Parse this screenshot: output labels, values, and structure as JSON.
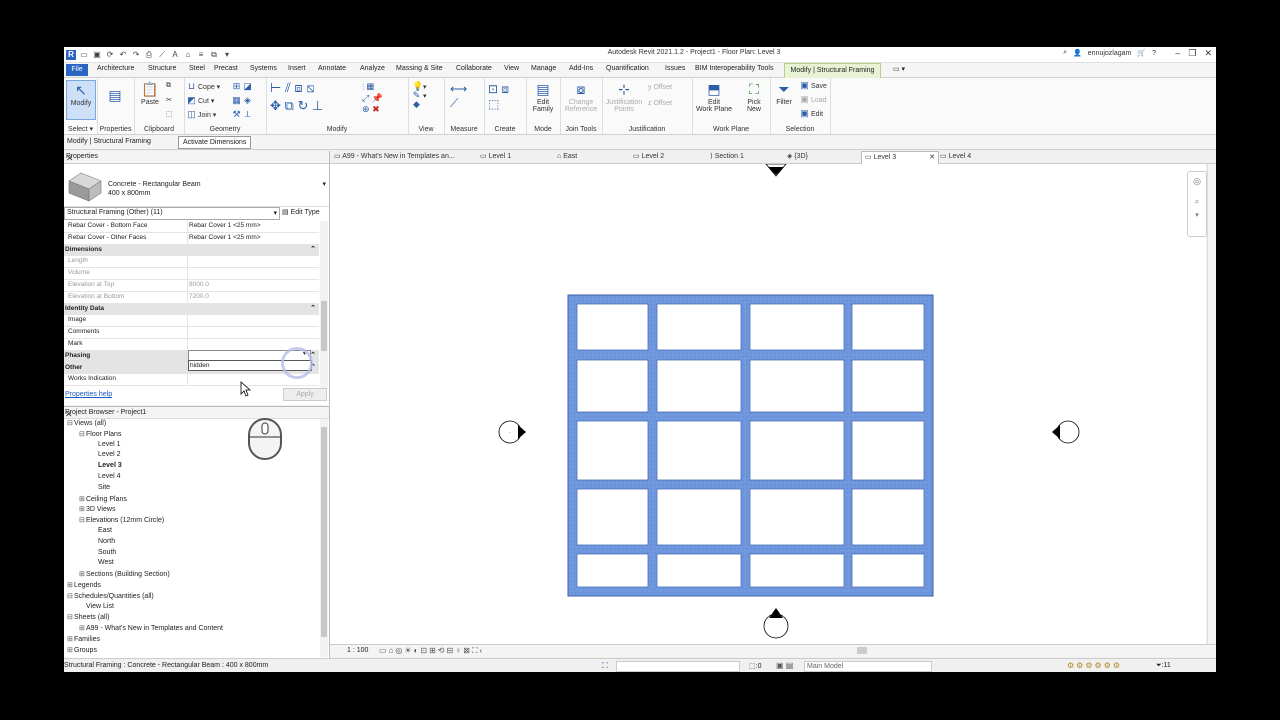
{
  "app": {
    "title": "Autodesk Revit 2021.1.2 - Project1 - Floor Plan: Level 3",
    "user": "ennujozlagam"
  },
  "ribbon_tabs": [
    "Architecture",
    "Structure",
    "Steel",
    "Precast",
    "Systems",
    "Insert",
    "Annotate",
    "Analyze",
    "Massing & Site",
    "Collaborate",
    "View",
    "Manage",
    "Add-Ins",
    "Quantification",
    "Issues",
    "BIM Interoperability Tools"
  ],
  "file_tab": "File",
  "active_tab": "Modify | Structural Framing",
  "ribbon": {
    "modify": "Modify",
    "select": "Select",
    "properties": "Properties",
    "paste": "Paste",
    "clipboard": "Clipboard",
    "cope": "Cope",
    "cut": "Cut",
    "join": "Join",
    "geometry": "Geometry",
    "modify_group": "Modify",
    "view": "View",
    "measure": "Measure",
    "create": "Create",
    "edit_family_1": "Edit",
    "edit_family_2": "Family",
    "mode": "Mode",
    "change_ref_1": "Change",
    "change_ref_2": "Reference",
    "join_tools": "Join Tools",
    "just_points_1": "Justification",
    "just_points_2": "Points",
    "y_offset": "y Offset",
    "z_offset": "z Offset",
    "justification": "Justification",
    "edit_wp_1": "Edit",
    "edit_wp_2": "Work Plane",
    "work_plane": "Work Plane",
    "pick_new_1": "Pick",
    "pick_new_2": "New",
    "filter": "Filter",
    "save": "Save",
    "load": "Load",
    "edit": "Edit",
    "selection": "Selection"
  },
  "context": {
    "label": "Modify | Structural Framing",
    "button": "Activate Dimensions"
  },
  "properties": {
    "title": "Properties",
    "type_line1": "Concrete - Rectangular Beam",
    "type_line2": "400 x 800mm",
    "filter": "Structural Framing (Other) (11)",
    "edit_type": "Edit Type",
    "rows": [
      {
        "k": "Rebar Cover - Bottom Face",
        "v": "Rebar Cover 1 <25 mm>",
        "kind": "row"
      },
      {
        "k": "Rebar Cover - Other Faces",
        "v": "Rebar Cover 1 <25 mm>",
        "kind": "row"
      },
      {
        "k": "Dimensions",
        "v": "",
        "kind": "grp"
      },
      {
        "k": "Length",
        "v": "",
        "kind": "dis"
      },
      {
        "k": "Volume",
        "v": "",
        "kind": "dis"
      },
      {
        "k": "Elevation at Top",
        "v": "8000.0",
        "kind": "dis"
      },
      {
        "k": "Elevation at Bottom",
        "v": "7200.0",
        "kind": "dis"
      },
      {
        "k": "Identity Data",
        "v": "",
        "kind": "grp"
      },
      {
        "k": "Image",
        "v": "",
        "kind": "row"
      },
      {
        "k": "Comments",
        "v": "",
        "kind": "row"
      },
      {
        "k": "Mark",
        "v": "",
        "kind": "row"
      },
      {
        "k": "Phasing",
        "v": "",
        "kind": "grp"
      },
      {
        "k": "Other",
        "v": "",
        "kind": "grp"
      },
      {
        "k": "Works Indication",
        "v": "",
        "kind": "row"
      }
    ],
    "dropdown_value": "hidden",
    "help": "Properties help",
    "apply": "Apply"
  },
  "browser": {
    "title": "Project Browser - Project1",
    "nodes": [
      {
        "label": "Views (all)",
        "depth": 0,
        "tog": "⊟"
      },
      {
        "label": "Floor Plans",
        "depth": 1,
        "tog": "⊟"
      },
      {
        "label": "Level 1",
        "depth": 2,
        "tog": ""
      },
      {
        "label": "Level 2",
        "depth": 2,
        "tog": ""
      },
      {
        "label": "Level 3",
        "depth": 2,
        "tog": "",
        "bold": true
      },
      {
        "label": "Level 4",
        "depth": 2,
        "tog": ""
      },
      {
        "label": "Site",
        "depth": 2,
        "tog": ""
      },
      {
        "label": "Ceiling Plans",
        "depth": 1,
        "tog": "⊞"
      },
      {
        "label": "3D Views",
        "depth": 1,
        "tog": "⊞"
      },
      {
        "label": "Elevations (12mm Circle)",
        "depth": 1,
        "tog": "⊟"
      },
      {
        "label": "East",
        "depth": 2,
        "tog": ""
      },
      {
        "label": "North",
        "depth": 2,
        "tog": ""
      },
      {
        "label": "South",
        "depth": 2,
        "tog": ""
      },
      {
        "label": "West",
        "depth": 2,
        "tog": ""
      },
      {
        "label": "Sections (Building Section)",
        "depth": 1,
        "tog": "⊞"
      },
      {
        "label": "Legends",
        "depth": 0,
        "tog": "⊞"
      },
      {
        "label": "Schedules/Quantities (all)",
        "depth": 0,
        "tog": "⊟"
      },
      {
        "label": "View List",
        "depth": 1,
        "tog": ""
      },
      {
        "label": "Sheets (all)",
        "depth": 0,
        "tog": "⊟"
      },
      {
        "label": "A99 - What's New in Templates and Content",
        "depth": 1,
        "tog": "⊞"
      },
      {
        "label": "Families",
        "depth": 0,
        "tog": "⊞"
      },
      {
        "label": "Groups",
        "depth": 0,
        "tog": "⊞"
      }
    ]
  },
  "view_tabs": [
    "A99 - What's New in Templates an...",
    "Level 1",
    "East",
    "Level 2",
    "Section 1",
    "{3D}",
    "Level 3",
    "Level 4"
  ],
  "active_view": "Level 3",
  "view_control": {
    "scale": "1 : 100"
  },
  "status": {
    "text": "Structural Framing : Concrete - Rectangular Beam : 400 x 800mm",
    "zero": ":0",
    "model": "Main Model",
    "filter_count": ":11"
  },
  "colors": {
    "beam": "#6f97de",
    "accent": "#2a65c4",
    "context_tab": "#e8f3d6"
  }
}
